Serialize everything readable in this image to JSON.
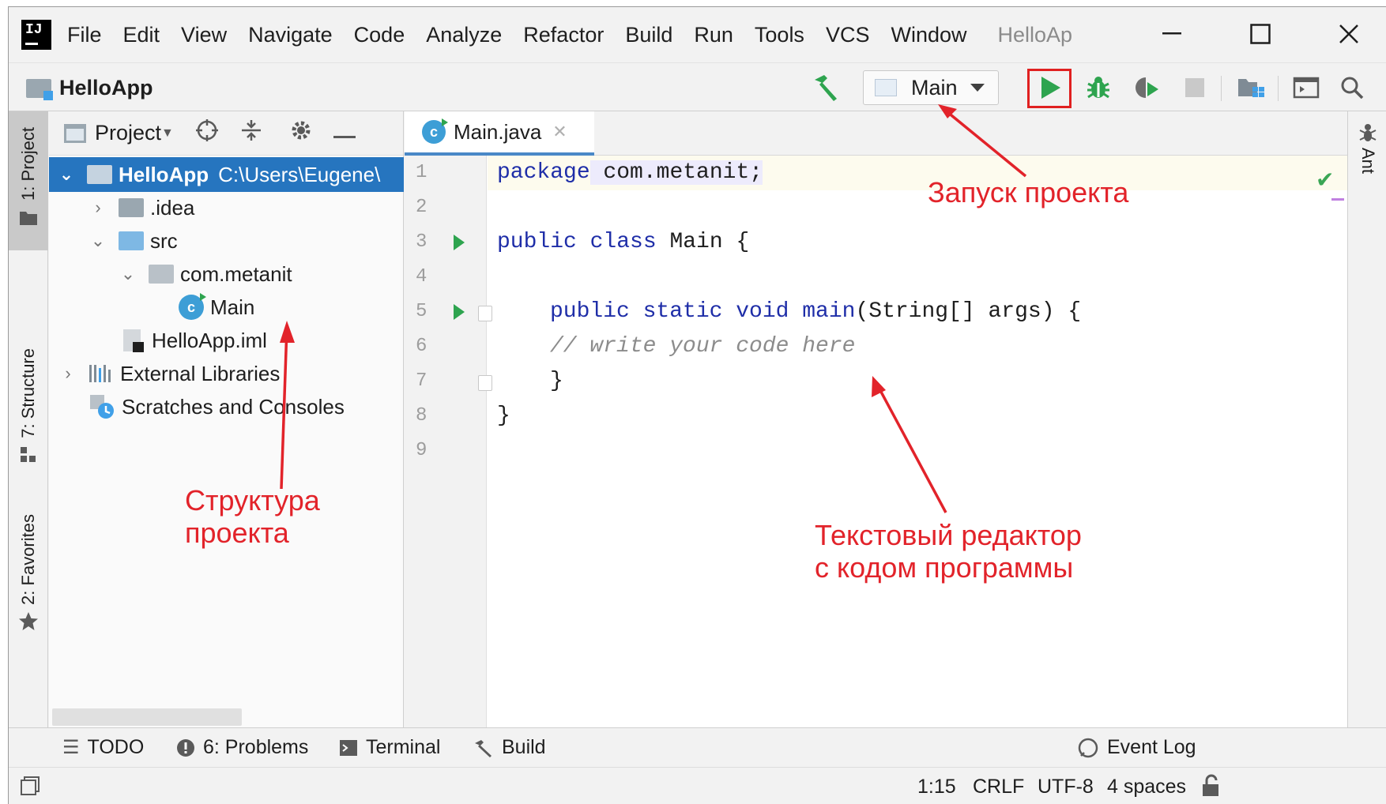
{
  "menubar": {
    "app_logo": "IJ",
    "items": [
      "File",
      "Edit",
      "View",
      "Navigate",
      "Code",
      "Analyze",
      "Refactor",
      "Build",
      "Run",
      "Tools",
      "VCS",
      "Window"
    ],
    "window_title": "HelloAp"
  },
  "toolbar": {
    "project_name": "HelloApp",
    "run_config": "Main",
    "icons": [
      "hammer-icon",
      "run-icon",
      "debug-icon",
      "coverage-icon",
      "stop-icon",
      "project-structure-icon",
      "terminal-icon",
      "search-icon"
    ]
  },
  "left_strip": {
    "tabs": [
      "1: Project",
      "7: Structure",
      "2: Favorites"
    ]
  },
  "right_strip": {
    "tabs": [
      "Ant"
    ]
  },
  "project_panel": {
    "title": "Project",
    "tree": [
      {
        "label": "HelloApp",
        "path": "C:\\Users\\Eugene\\",
        "expanded": true,
        "selected": true
      },
      {
        "label": ".idea",
        "expanded": false
      },
      {
        "label": "src",
        "expanded": true
      },
      {
        "label": "com.metanit",
        "expanded": true
      },
      {
        "label": "Main"
      },
      {
        "label": "HelloApp.iml"
      },
      {
        "label": "External Libraries",
        "expanded": false
      },
      {
        "label": "Scratches and Consoles"
      }
    ]
  },
  "editor": {
    "tab_label": "Main.java",
    "line_numbers": [
      "1",
      "2",
      "3",
      "4",
      "5",
      "6",
      "7",
      "8",
      "9"
    ],
    "code": {
      "l1_kw": "package",
      "l1_rest": " com.metanit;",
      "l3_kw": "public class",
      "l3_rest": " Main {",
      "l5_kw": "public static void",
      "l5_fn": " main",
      "l5_rest": "(String[] args) {",
      "l6_comment": "// write your code here",
      "l7": "}",
      "l8": "}"
    }
  },
  "annotations": {
    "run": "Запуск проекта",
    "structure_line1": "Структура",
    "structure_line2": "проекта",
    "editor_line1": "Текстовый редактор",
    "editor_line2": "с кодом программы",
    "color": "#e2232a"
  },
  "bottom_bar": {
    "todo": "TODO",
    "problems": "6: Problems",
    "terminal": "Terminal",
    "build": "Build",
    "event_log": "Event Log"
  },
  "status_bar": {
    "position": "1:15",
    "line_sep": "CRLF",
    "encoding": "UTF-8",
    "indent": "4 spaces"
  },
  "colors": {
    "selection": "#2675bf",
    "keyword": "#1f2ea8",
    "run_green": "#2ea44f"
  }
}
